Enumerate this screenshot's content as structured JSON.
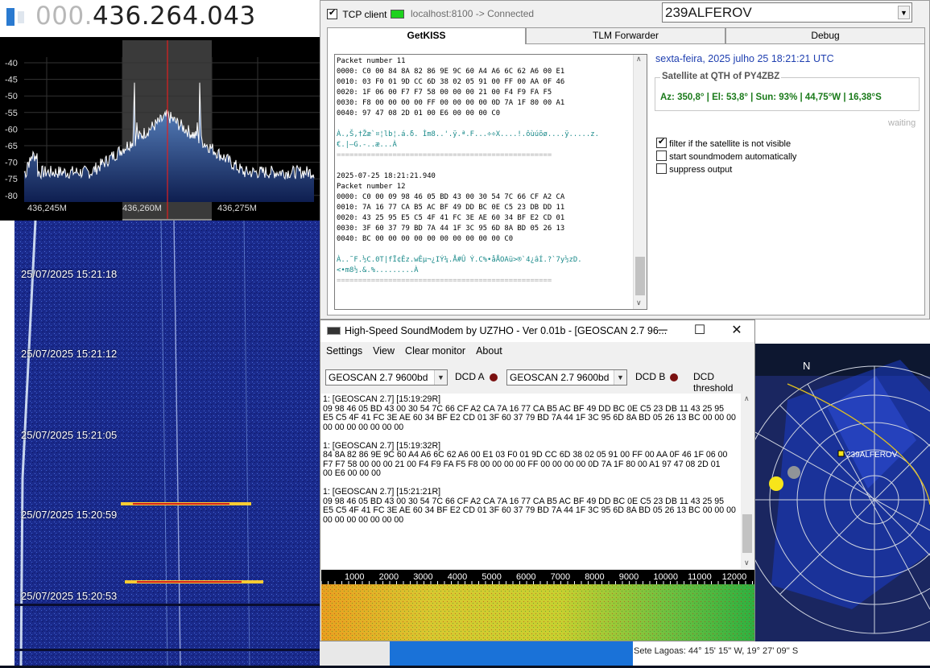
{
  "sdr": {
    "freq_dim": "000.",
    "freq_main": "436.264.043",
    "y_ticks": [
      "-40",
      "-45",
      "-50",
      "-55",
      "-60",
      "-65",
      "-70",
      "-75",
      "-80"
    ],
    "x_ticks": [
      "436,245M",
      "436,260M",
      "436,275M"
    ]
  },
  "waterfall": {
    "timestamps": [
      "25/07/2025 15:21:18",
      "25/07/2025 15:21:12",
      "25/07/2025 15:21:05",
      "25/07/2025 15:20:59",
      "25/07/2025 15:20:53"
    ]
  },
  "getkiss": {
    "tcp_label": "TCP client",
    "tcp_status": "localhost:8100 -> Connected",
    "satellite": "239ALFEROV",
    "tabs": [
      "GetKISS",
      "TLM Forwarder",
      "Debug"
    ],
    "datetime": "sexta-feira, 2025 julho 25  18:21:21 UTC",
    "group_title": "Satellite at QTH of PY4ZBZ",
    "sat_info": "Az: 350,8° | El: 53,8° | Sun: 93% | 44,75°W | 16,38°S",
    "waiting": "waiting",
    "opt_filter": "filter if the satellite is not visible",
    "opt_start": "start soundmodem automatically",
    "opt_suppress": "suppress output",
    "packet_log": "Packet number 11\n0000: C0 00 84 8A 82 86 9E 9C 60 A4 A6 6C 62 A6 00 E1\n0010: 03 F0 01 9D CC 6D 38 02 05 91 00 FF 00 AA 0F 46\n0020: 1F 06 00 F7 F7 58 00 00 00 21 00 F4 F9 FA F5\n0030: F8 00 00 00 00 FF 00 00 00 00 0D 7A 1F 80 00 A1\n0040: 97 47 08 2D 01 00 E6 00 00 00 C0",
    "packet_text1": "À.,Š,†Žæ`¤¦lb¦.á.δ. Ìm8..'.ÿ.ª.F...÷÷X....!.ôùúõø....ÿ.....z.\n€.|—G.-..æ...À",
    "separator": "==================================================",
    "packet_ts": "2025-07-25 18:21:21.940",
    "packet_log2": "Packet number 12\n0000: C0 00 09 98 46 05 BD 43 00 30 54 7C 66 CF A2 CA\n0010: 7A 16 77 CA B5 AC BF 49 DD BC 0E C5 23 DB DD 11\n0020: 43 25 95 E5 C5 4F 41 FC 3E AE 60 34 BF E2 CD 01\n0030: 3F 60 37 79 BD 7A 44 1F 3C 95 6D 8A BD 05 26 13\n0040: BC 00 00 00 00 00 00 00 00 00 00 C0",
    "packet_text2": "À..˜F.½C.0T|fÏ¢Êz.wÊµ¬¿IÝ¼.Å#Û Ý.C%•åÅOAü>®`4¿âÍ.?`7y½zD.\n<•m8½.&.%.........À"
  },
  "soundmodem": {
    "title": "High-Speed SoundModem by UZ7HO - Ver 0.01b - [GEOSCAN 2.7 96...",
    "menu": [
      "Settings",
      "View",
      "Clear monitor",
      "About"
    ],
    "mode_a": "GEOSCAN 2.7 9600bd",
    "mode_b": "GEOSCAN 2.7 9600bd",
    "dcd_a": "DCD A",
    "dcd_b": "DCD B",
    "dcd_threshold": "DCD threshold",
    "monitor": "1: [GEOSCAN 2.7] [15:19:29R]\n09 98 46 05 BD 43 00 30 54 7C 66 CF A2 CA 7A 16 77 CA B5 AC BF 49 DD BC 0E C5 23 DB 11 43 25 95\nE5 C5 4F 41 FC 3E AE 60 34 BF E2 CD 01 3F 60 37 79 BD 7A 44 1F 3C 95 6D 8A BD 05 26 13 BC 00 00 00\n00 00 00 00 00 00 00\n\n1: [GEOSCAN 2.7] [15:19:32R]\n84 8A 82 86 9E 9C 60 A4 A6 6C 62 A6 00 E1 03 F0 01 9D CC 6D 38 02 05 91 00 FF 00 AA 0F 46 1F 06 00\nF7 F7 58 00 00 00 21 00 F4 F9 FA F5 F8 00 00 00 00 FF 00 00 00 00 0D 7A 1F 80 00 A1 97 47 08 2D 01\n00 E6 00 00 00\n\n1: [GEOSCAN 2.7] [15:21:21R]\n09 98 46 05 BD 43 00 30 54 7C 66 CF A2 CA 7A 16 77 CA B5 AC BF 49 DD BC 0E C5 23 DB 11 43 25 95\nE5 C5 4F 41 FC 3E AE 60 34 BF E2 CD 01 3F 60 37 79 BD 7A 44 1F 3C 95 6D 8A BD 05 26 13 BC 00 00 00\n00 00 00 00 00 00 00",
    "freq_ruler": [
      "1000",
      "2000",
      "3000",
      "4000",
      "5000",
      "6000",
      "7000",
      "8000",
      "9000",
      "10000",
      "11000",
      "12000"
    ]
  },
  "polar": {
    "north": "N",
    "sat_label": "239ALFEROV"
  },
  "location": "Sete Lagoas: 44° 15' 15'' W, 19° 27' 09'' S"
}
